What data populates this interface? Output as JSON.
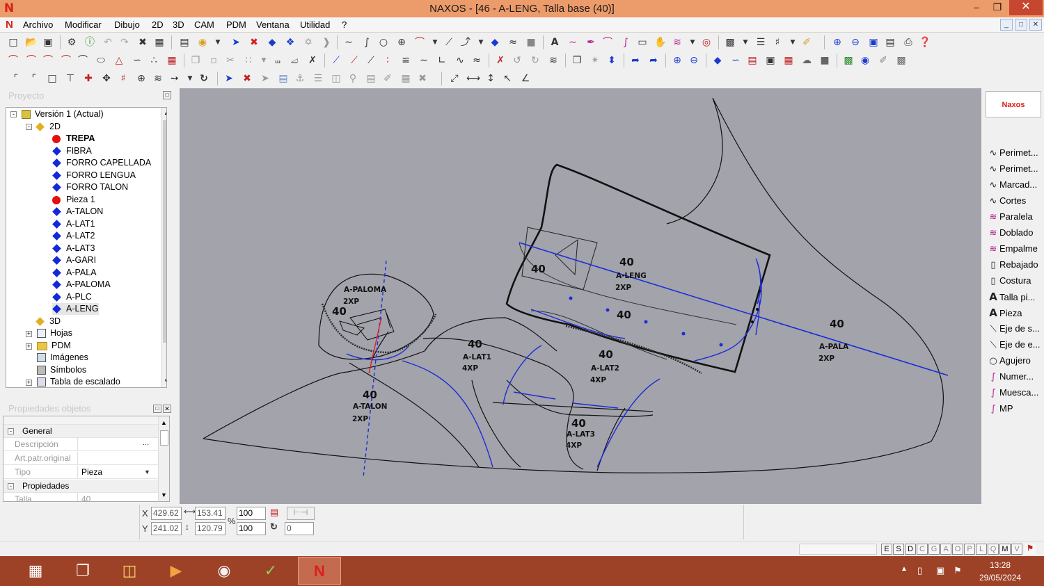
{
  "window": {
    "title": "NAXOS - [46 - A-LENG, Talla base (40)]",
    "min": "–",
    "max": "❐",
    "close": "✕"
  },
  "menu": {
    "items": [
      "Archivo",
      "Modificar",
      "Dibujo",
      "2D",
      "3D",
      "CAM",
      "PDM",
      "Ventana",
      "Utilidad",
      "?"
    ]
  },
  "project": {
    "title": "Proyecto",
    "tree": [
      {
        "label": "Versión 1 (Actual)",
        "type": "root"
      },
      {
        "label": "2D",
        "type": "folder2d"
      },
      {
        "label": "TREPA",
        "type": "red",
        "bold": true
      },
      {
        "label": "FIBRA",
        "type": "blue"
      },
      {
        "label": "FORRO CAPELLADA",
        "type": "blue"
      },
      {
        "label": "FORRO LENGUA",
        "type": "blue"
      },
      {
        "label": "FORRO TALON",
        "type": "blue"
      },
      {
        "label": "Pieza 1",
        "type": "red"
      },
      {
        "label": "A-TALON",
        "type": "blue"
      },
      {
        "label": "A-LAT1",
        "type": "blue"
      },
      {
        "label": "A-LAT2",
        "type": "blue"
      },
      {
        "label": "A-LAT3",
        "type": "blue"
      },
      {
        "label": "A-GARI",
        "type": "blue"
      },
      {
        "label": "A-PALA",
        "type": "blue"
      },
      {
        "label": "A-PALOMA",
        "type": "blue"
      },
      {
        "label": "A-PLC",
        "type": "blue"
      },
      {
        "label": "A-LENG",
        "type": "blue"
      },
      {
        "label": "3D",
        "type": "folder3d"
      },
      {
        "label": "Hojas",
        "type": "sheets"
      },
      {
        "label": "PDM",
        "type": "pdm"
      },
      {
        "label": "Imágenes",
        "type": "images"
      },
      {
        "label": "Símbolos",
        "type": "symbols"
      },
      {
        "label": "Tabla de escalado",
        "type": "table"
      }
    ]
  },
  "properties": {
    "title": "Propiedades objetos",
    "general": "General",
    "desc_label": "Descripción",
    "artpatr_label": "Art.patr.original",
    "tipo_label": "Tipo",
    "tipo_value": "Pieza",
    "props_group": "Propiedades",
    "talla_label": "Talla",
    "talla_value": "40"
  },
  "right_panel": {
    "logo": "Naxos",
    "items": [
      {
        "label": "Perimet...",
        "icon": "curve-icon"
      },
      {
        "label": "Perimet...",
        "icon": "curve-icon"
      },
      {
        "label": "Marcad...",
        "icon": "curve-icon"
      },
      {
        "label": "Cortes",
        "icon": "curve-icon"
      },
      {
        "label": "Paralela",
        "icon": "parallel-icon"
      },
      {
        "label": "Doblado",
        "icon": "fold-icon"
      },
      {
        "label": "Empalme",
        "icon": "join-icon"
      },
      {
        "label": "Rebajado",
        "icon": "skive-icon"
      },
      {
        "label": "Costura",
        "icon": "seam-icon"
      },
      {
        "label": "Talla pi...",
        "icon": "text-icon"
      },
      {
        "label": "Pieza",
        "icon": "text-icon"
      },
      {
        "label": "Eje de s...",
        "icon": "axis-icon"
      },
      {
        "label": "Eje de e...",
        "icon": "axis-icon"
      },
      {
        "label": "Agujero",
        "icon": "hole-icon"
      },
      {
        "label": "Numer...",
        "icon": "number-icon"
      },
      {
        "label": "Muesca...",
        "icon": "notch-icon"
      },
      {
        "label": "MP",
        "icon": "mp-icon"
      }
    ]
  },
  "coords": {
    "x_label": "X",
    "y_label": "Y",
    "x": "429.62",
    "y": "241.02",
    "w": "153.41",
    "h": "120.79",
    "pct_label": "%",
    "sx": "100",
    "sy": "100",
    "angle": "0"
  },
  "status_keys": [
    "E",
    "S",
    "D",
    "C",
    "G",
    "A",
    "O",
    "P",
    "L",
    "Q",
    "M",
    "V"
  ],
  "canvas_labels": [
    {
      "id": "paloma",
      "size": "40",
      "name": "A-PALOMA",
      "qty": "2XP"
    },
    {
      "id": "talon",
      "size": "40",
      "name": "A-TALON",
      "qty": "2XP"
    },
    {
      "id": "lat1",
      "size": "40",
      "name": "A-LAT1",
      "qty": "4XP"
    },
    {
      "id": "lat2",
      "size": "40",
      "name": "A-LAT2",
      "qty": "4XP"
    },
    {
      "id": "lat3",
      "size": "40",
      "name": "A-LAT3",
      "qty": "4XP"
    },
    {
      "id": "leng",
      "size": "40",
      "name": "A-LENG",
      "qty": "2XP"
    },
    {
      "id": "pala",
      "size": "40",
      "name": "A-PALA",
      "qty": "2XP"
    },
    {
      "id": "plc",
      "size": "40",
      "name": "",
      "qty": ""
    },
    {
      "id": "lat2b",
      "size": "40",
      "name": "",
      "qty": ""
    }
  ],
  "taskbar": {
    "time": "13:28",
    "date": "29/05/2024"
  }
}
